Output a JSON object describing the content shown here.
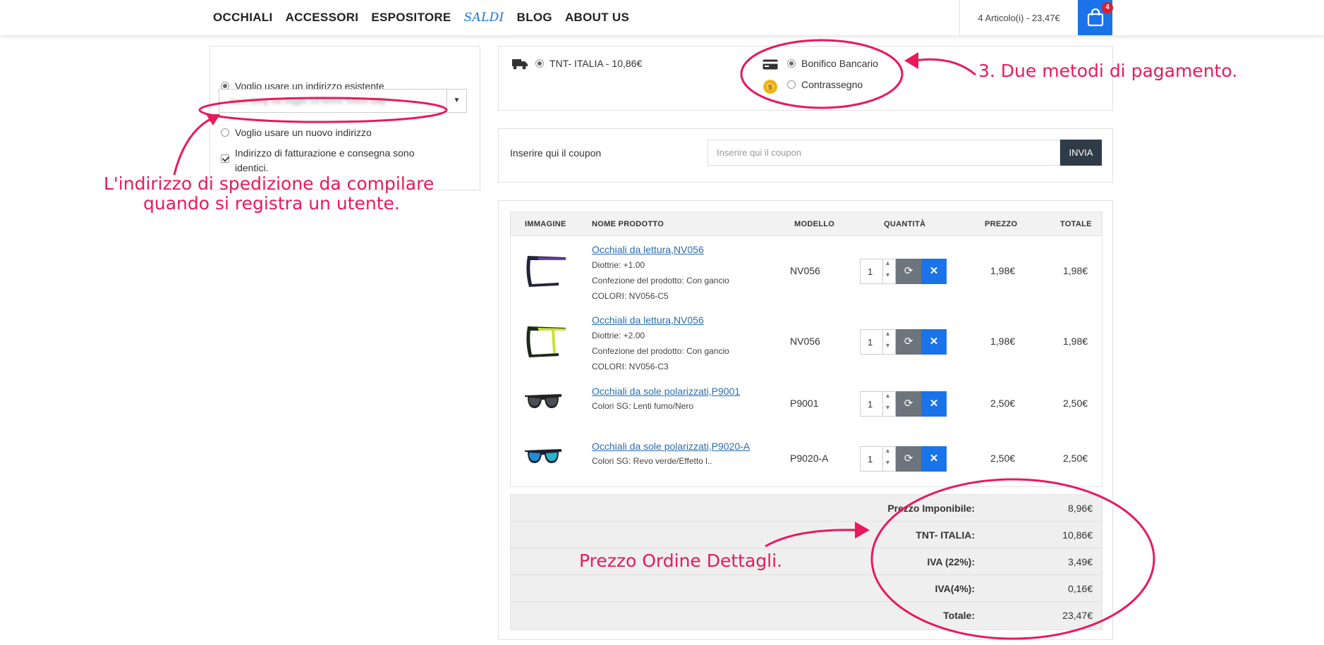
{
  "header": {
    "nav": [
      {
        "label": "OCCHIALI"
      },
      {
        "label": "ACCESSORI"
      },
      {
        "label": "ESPOSITORE"
      },
      {
        "label": "SALDI"
      },
      {
        "label": "BLOG"
      },
      {
        "label": "ABOUT US"
      }
    ],
    "cart_summary": "4 Articolo(i) - 23,47€",
    "cart_count": "4"
  },
  "address": {
    "option_existing": "Voglio usare un indirizzo esistente",
    "existing_value": "zuua song via reggio 14 torino Torino Italy",
    "option_new": "Voglio usare un nuovo indirizzo",
    "same_address": "Indirizzo di fatturazione e consegna sono identici."
  },
  "shipping": {
    "method": "TNT- ITALIA - 10,86€"
  },
  "payment": {
    "methods": [
      {
        "label": "Bonifico Bancario",
        "selected": true
      },
      {
        "label": "Contrassegno",
        "selected": false
      }
    ]
  },
  "coupon": {
    "label": "Inserire qui il coupon",
    "placeholder": "Inserire qui il coupon",
    "button": "INVIA"
  },
  "cart_table": {
    "headers": [
      "IMMAGINE",
      "NOME PRODOTTO",
      "MODELLO",
      "QUANTITÀ",
      "PREZZO",
      "TOTALE"
    ],
    "items": [
      {
        "name": "Occhiali da lettura,NV056",
        "options": [
          "Diottrie: +1.00",
          "Confezione del prodotto: Con gancio",
          "COLORI: NV056-C5"
        ],
        "model": "NV056",
        "qty": "1",
        "price": "1,98€",
        "total": "1,98€",
        "image": "reading-glasses-purple"
      },
      {
        "name": "Occhiali da lettura,NV056",
        "options": [
          "Diottrie: +2.00",
          "Confezione del prodotto: Con gancio",
          "COLORI: NV056-C3"
        ],
        "model": "NV056",
        "qty": "1",
        "price": "1,98€",
        "total": "1,98€",
        "image": "reading-glasses-yellow"
      },
      {
        "name": "Occhiali da sole polarizzati,P9001",
        "options": [
          "Colori SG: Lenti fumo/Nero"
        ],
        "model": "P9001",
        "qty": "1",
        "price": "2,50€",
        "total": "2,50€",
        "image": "sunglasses-black"
      },
      {
        "name": "Occhiali da sole polarizzati,P9020-A",
        "options": [
          "Colori SG: Revo verde/Effetto l.."
        ],
        "model": "P9020-A",
        "qty": "1",
        "price": "2,50€",
        "total": "2,50€",
        "image": "sunglasses-blue"
      }
    ]
  },
  "totals": [
    {
      "label": "Prezzo Imponibile:",
      "value": "8,96€"
    },
    {
      "label": "TNT- ITALIA:",
      "value": "10,86€"
    },
    {
      "label": "IVA (22%):",
      "value": "3,49€"
    },
    {
      "label": "IVA(4%):",
      "value": "0,16€"
    },
    {
      "label": "Totale:",
      "value": "23,47€"
    }
  ],
  "annotations": {
    "address_note_line1": "L'indirizzo di spedizione da compilare",
    "address_note_line2": "quando si registra un utente.",
    "payment_note": "3. Due metodi di pagamento.",
    "totals_note": "Prezzo Ordine Dettagli."
  },
  "colors": {
    "accent": "#1a73e8",
    "annotation": "#e8195b",
    "dark_button": "#2f3b47"
  }
}
